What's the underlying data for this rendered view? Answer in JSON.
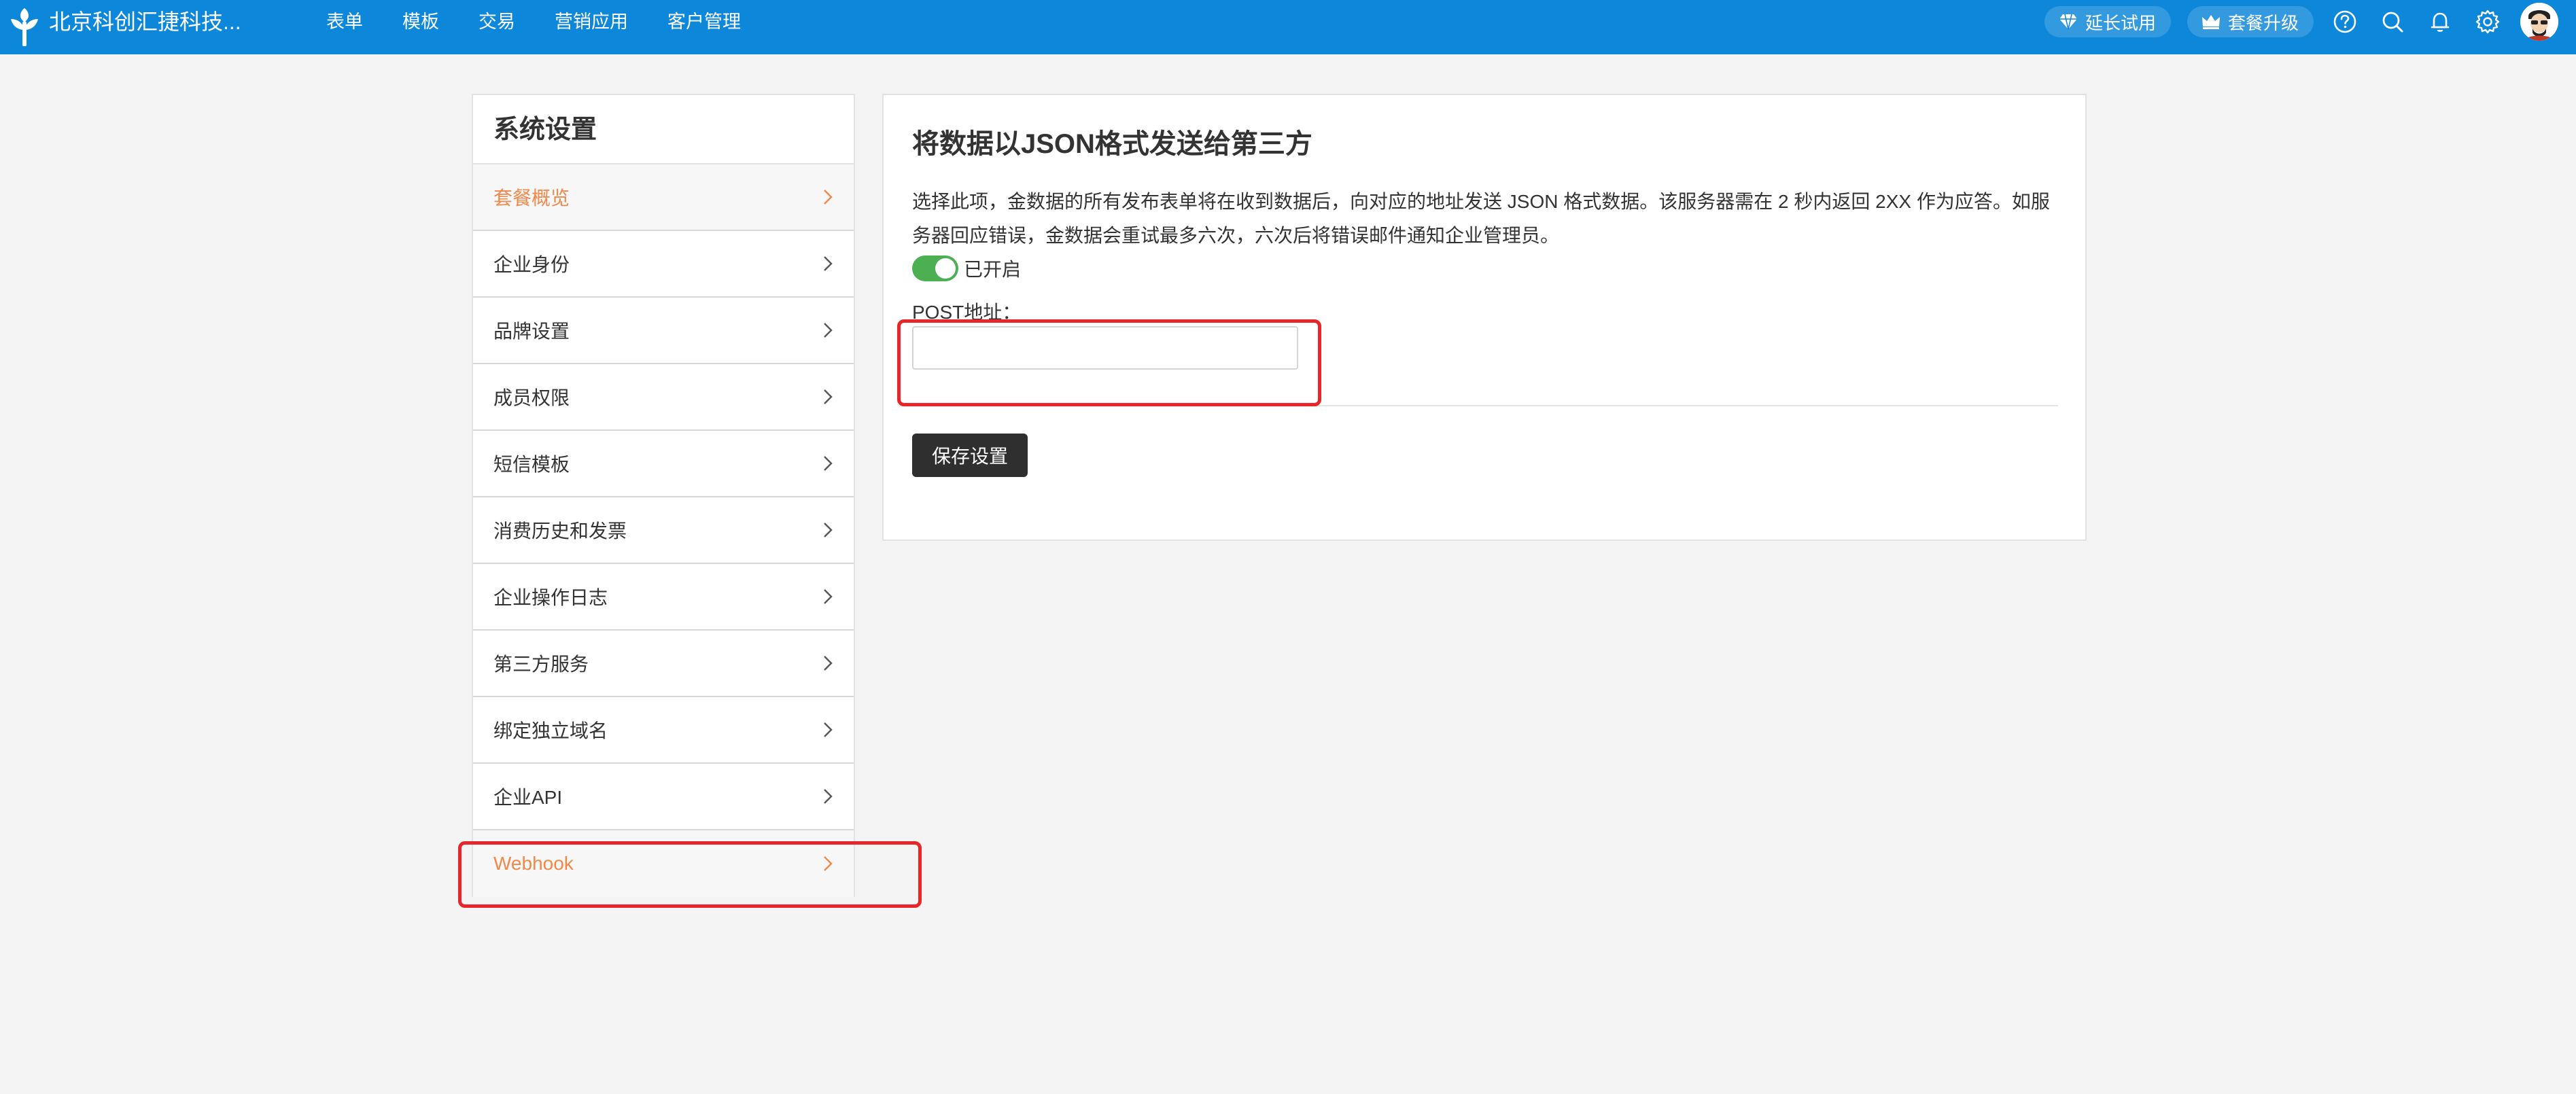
{
  "header": {
    "company": "北京科创汇捷科技...",
    "nav": [
      "表单",
      "模板",
      "交易",
      "营销应用",
      "客户管理"
    ],
    "extend_trial": "延长试用",
    "upgrade_plan": "套餐升级",
    "icons": [
      "help-icon",
      "search-icon",
      "bell-icon",
      "gear-icon",
      "avatar"
    ],
    "bar_color": "#0d87d9"
  },
  "sidebar": {
    "title": "系统设置",
    "items": [
      {
        "label": "套餐概览"
      },
      {
        "label": "企业身份"
      },
      {
        "label": "品牌设置"
      },
      {
        "label": "成员权限"
      },
      {
        "label": "短信模板"
      },
      {
        "label": "消费历史和发票"
      },
      {
        "label": "企业操作日志"
      },
      {
        "label": "第三方服务"
      },
      {
        "label": "绑定独立域名"
      },
      {
        "label": "企业API"
      },
      {
        "label": "Webhook"
      }
    ],
    "accent_color": "#f0884a"
  },
  "panel": {
    "title": "将数据以JSON格式发送给第三方",
    "description": "选择此项，金数据的所有发布表单将在收到数据后，向对应的地址发送 JSON 格式数据。该服务器需在 2 秒内返回 2XX 作为应答。如服务器回应错误，金数据会重试最多六次，六次后将错误邮件通知企业管理员。",
    "toggle_label": "已开启",
    "toggle_color": "#4cb052",
    "post_label": "POST地址：",
    "post_value": "",
    "save_label": "保存设置"
  },
  "highlight_color": "#e8262a"
}
